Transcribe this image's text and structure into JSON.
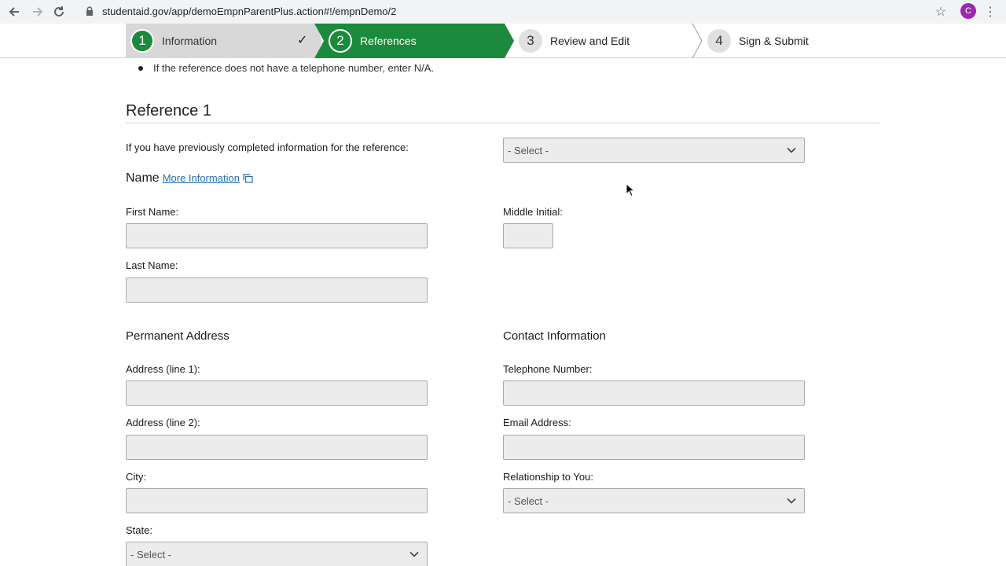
{
  "browser": {
    "url": "studentaid.gov/app/demoEmpnParentPlus.action#!/empnDemo/2",
    "profile_initial": "C"
  },
  "steps": [
    {
      "num": "1",
      "label": "Information"
    },
    {
      "num": "2",
      "label": "References"
    },
    {
      "num": "3",
      "label": "Review and Edit"
    },
    {
      "num": "4",
      "label": "Sign & Submit"
    }
  ],
  "instructions": {
    "bullet": "If the reference does not have a telephone number, enter N/A."
  },
  "reference": {
    "title": "Reference 1",
    "prev_label": "If you have previously completed information for the reference:",
    "prev_select": "- Select -",
    "name_label": "Name",
    "more_info": "More Information",
    "first_name_label": "First Name:",
    "middle_initial_label": "Middle Initial:",
    "last_name_label": "Last Name:",
    "address_heading": "Permanent Address",
    "address1_label": "Address (line 1):",
    "address2_label": "Address (line 2):",
    "city_label": "City:",
    "state_label": "State:",
    "state_select": "- Select -",
    "contact_heading": "Contact Information",
    "phone_label": "Telephone Number:",
    "email_label": "Email Address:",
    "relationship_label": "Relationship to You:",
    "relationship_select": "- Select -"
  },
  "colors": {
    "step_active": "#1b8a3c",
    "link": "#1f6fb2"
  }
}
